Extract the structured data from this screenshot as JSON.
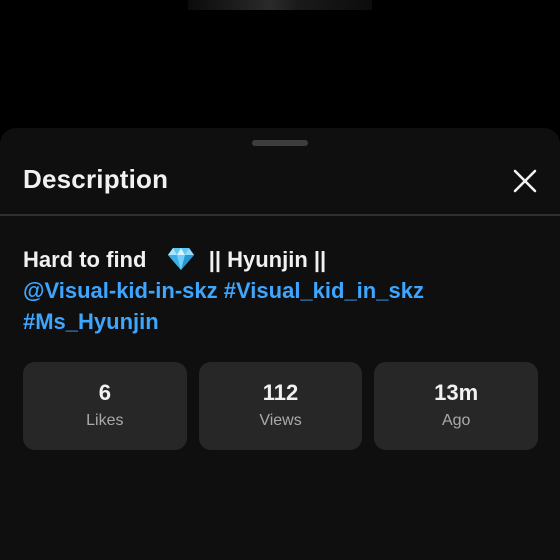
{
  "panel": {
    "title": "Description"
  },
  "description": {
    "text_before": "Hard to find",
    "gem_icon": "gem-icon",
    "text_after": "|| Hyunjin ||",
    "mention": "@Visual-kid-in-skz",
    "hashtag1": "#Visual_kid_in_skz",
    "hashtag2": "#Ms_Hyunjin"
  },
  "stats": [
    {
      "value": "6",
      "label": "Likes"
    },
    {
      "value": "112",
      "label": "Views"
    },
    {
      "value": "13m",
      "label": "Ago"
    }
  ],
  "colors": {
    "sheet_background": "#0f0f0f",
    "stat_card": "#272727",
    "link": "#3ea6ff",
    "primary_text": "#f1f1f1",
    "secondary_text": "#aaaaaa"
  }
}
